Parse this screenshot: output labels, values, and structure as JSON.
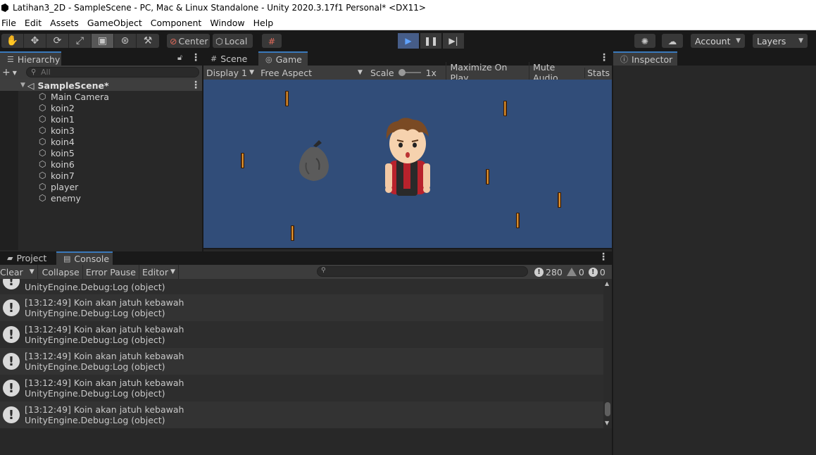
{
  "window": {
    "title": "Latihan3_2D - SampleScene - PC, Mac & Linux Standalone - Unity 2020.3.17f1 Personal* <DX11>"
  },
  "menu": [
    "File",
    "Edit",
    "Assets",
    "GameObject",
    "Component",
    "Window",
    "Help"
  ],
  "toolbar": {
    "tools": [
      "hand-icon",
      "move-icon",
      "rotate-icon",
      "scale-icon",
      "rect-tool-icon",
      "transform-icon",
      "custom-tool-icon"
    ],
    "pivot_label": "Center",
    "space_label": "Local",
    "account_label": "Account",
    "layers_label": "Layers",
    "play_state": "playing"
  },
  "hierarchy": {
    "tab_label": "Hierarchy",
    "search_placeholder": "All",
    "scene_name": "SampleScene*",
    "items": [
      "Main Camera",
      "koin2",
      "koin1",
      "koin3",
      "koin4",
      "koin5",
      "koin6",
      "koin7",
      "player",
      "enemy"
    ]
  },
  "center_tabs": {
    "scene": "Scene",
    "game": "Game"
  },
  "game_bar": {
    "display": "Display 1",
    "aspect": "Free Aspect",
    "scale_label": "Scale",
    "scale_value": "1x",
    "maximize": "Maximize On Play",
    "mute": "Mute Audio",
    "stats": "Stats"
  },
  "inspector": {
    "tab_label": "Inspector"
  },
  "bottom_tabs": {
    "project": "Project",
    "console": "Console"
  },
  "console": {
    "clear": "Clear",
    "collapse": "Collapse",
    "error_pause": "Error Pause",
    "editor": "Editor",
    "log_count": "280",
    "warning_count": "0",
    "error_count": "0",
    "partial_first": "UnityEngine.Debug:Log (object)",
    "entries": [
      {
        "line1": "[13:12:49] Koin akan jatuh kebawah",
        "line2": "UnityEngine.Debug:Log (object)"
      },
      {
        "line1": "[13:12:49] Koin akan jatuh kebawah",
        "line2": "UnityEngine.Debug:Log (object)"
      },
      {
        "line1": "[13:12:49] Koin akan jatuh kebawah",
        "line2": "UnityEngine.Debug:Log (object)"
      },
      {
        "line1": "[13:12:49] Koin akan jatuh kebawah",
        "line2": "UnityEngine.Debug:Log (object)"
      },
      {
        "line1": "[13:12:49] Koin akan jatuh kebawah",
        "line2": "UnityEngine.Debug:Log (object)"
      }
    ]
  },
  "colors": {
    "game_background": "#314d79",
    "play_active": "#465d88",
    "tab_accent": "#3a79bb"
  }
}
